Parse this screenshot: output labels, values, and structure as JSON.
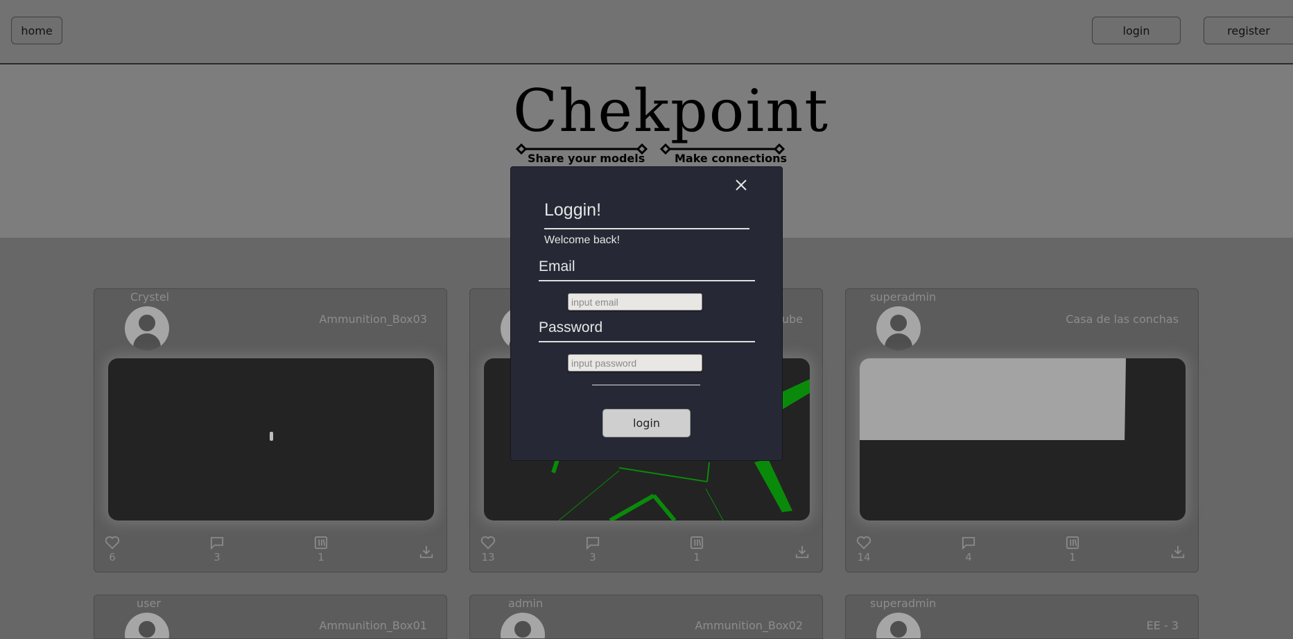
{
  "nav": {
    "home_label": "home",
    "login_label": "login",
    "register_label": "register"
  },
  "logo": {
    "title": "Chekpoint",
    "tagline_left": "Share your models",
    "tagline_right": "Make connections"
  },
  "cards": [
    {
      "author": "Crystel",
      "model": "Ammunition_Box03",
      "likes": "6",
      "comments": "3",
      "collections": "1"
    },
    {
      "author": "",
      "model": "cube",
      "likes": "13",
      "comments": "3",
      "collections": "1"
    },
    {
      "author": "superadmin",
      "model": "Casa de las conchas",
      "likes": "14",
      "comments": "4",
      "collections": "1"
    },
    {
      "author": "user",
      "model": "Ammunition_Box01"
    },
    {
      "author": "admin",
      "model": "Ammunition_Box02"
    },
    {
      "author": "superadmin",
      "model": "EE - 3"
    }
  ],
  "modal": {
    "title": "Loggin!",
    "subtitle": "Welcome back!",
    "email_label": "Email",
    "email_placeholder": "input email",
    "email_value": "",
    "password_label": "Password",
    "password_placeholder": "input password",
    "password_value": "",
    "submit_label": "login"
  },
  "icons": {
    "close": "close-icon",
    "like": "heart-icon",
    "comment": "comment-icon",
    "collection": "library-icon",
    "download": "download-icon",
    "avatar": "user-avatar-icon"
  },
  "colors": {
    "background": "#676767",
    "modal_bg": "#262935",
    "viewer_bg": "#232323",
    "model_green": "#0a8a0a"
  }
}
